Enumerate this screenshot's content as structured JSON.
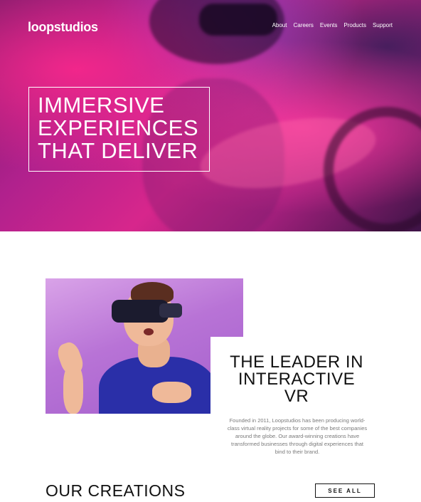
{
  "header": {
    "logo": "loopstudios",
    "nav": [
      "About",
      "Careers",
      "Events",
      "Products",
      "Support"
    ]
  },
  "hero": {
    "title_lines": [
      "IMMERSIVE",
      "EXPERIENCES",
      "THAT DELIVER"
    ]
  },
  "about": {
    "title_lines": [
      "THE LEADER IN",
      "INTERACTIVE",
      "VR"
    ],
    "text": "Founded in 2011, Loopstudios has been producing world-class virtual reality projects for some of the best companies around the globe. Our award-winning creations have transformed businesses through digital experiences that bind to their brand."
  },
  "creations": {
    "title": "OUR CREATIONS",
    "see_all_label": "SEE ALL"
  }
}
